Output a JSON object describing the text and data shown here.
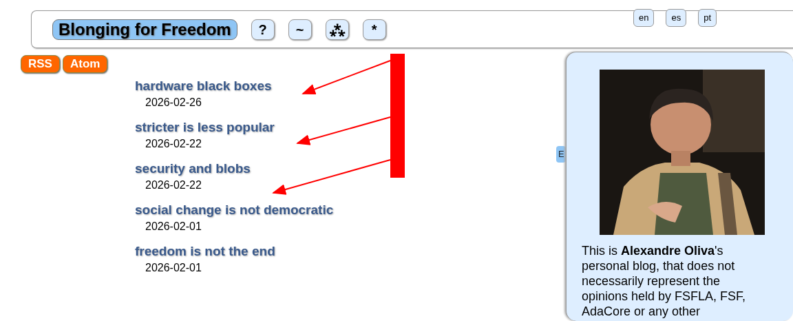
{
  "header": {
    "title": "Blonging for Freedom",
    "buttons": [
      "?",
      "~",
      "⁂",
      "*"
    ],
    "languages": [
      {
        "label": "en"
      },
      {
        "label": "es"
      },
      {
        "label": "pt"
      }
    ]
  },
  "feeds": [
    "RSS",
    "Atom"
  ],
  "posts": [
    {
      "title": "hardware black boxes",
      "date": "2026-02-26"
    },
    {
      "title": "stricter is less popular",
      "date": "2026-02-22"
    },
    {
      "title": "security and blobs",
      "date": "2026-02-22"
    },
    {
      "title": "social change is not democratic",
      "date": "2026-02-01"
    },
    {
      "title": "freedom is not the end",
      "date": "2026-02-01"
    }
  ],
  "hidden_tab": {
    "label": "E"
  },
  "sidebar": {
    "intro_before": "This is ",
    "intro_link": "Alexandre Oliva",
    "intro_after": "'s personal blog, that does not necessarily represent the opinions held by FSFLA, FSF, AdaCore or any other"
  }
}
